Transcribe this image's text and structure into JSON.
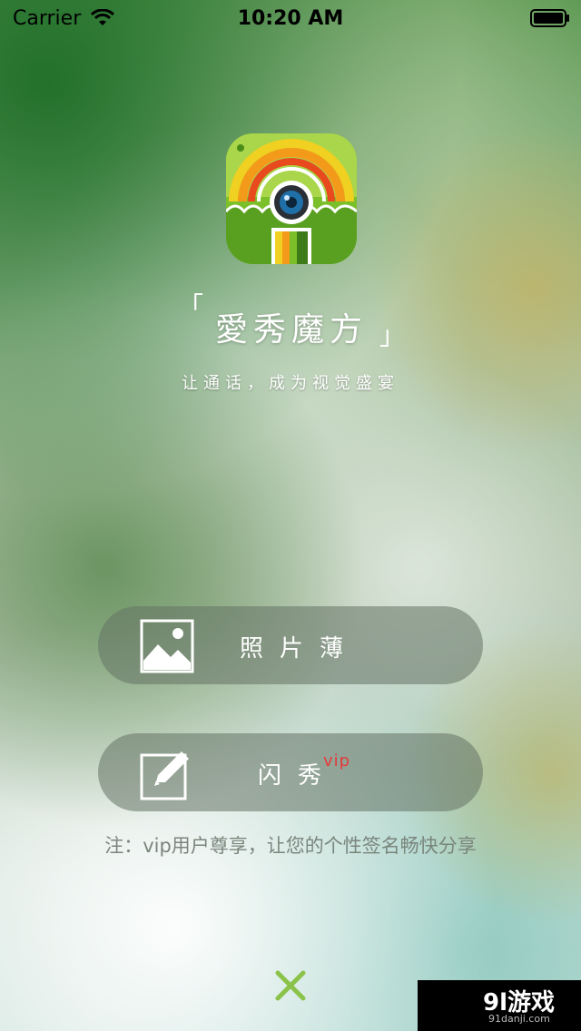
{
  "status_bar": {
    "carrier": "Carrier",
    "time": "10:20 AM"
  },
  "header": {
    "app_icon": "rainbow-camera-app-icon",
    "title_open_bracket": "「",
    "title": "愛秀魔方",
    "title_close_bracket": "」",
    "slogan": "让通话，成为视觉盛宴"
  },
  "buttons": {
    "album": {
      "label": "照片薄",
      "icon": "image-icon"
    },
    "flash_show": {
      "label": "闪秀",
      "badge": "vip",
      "icon": "edit-icon"
    }
  },
  "note": "注：vip用户尊享，让您的个性签名畅快分享",
  "close_icon": "close-icon",
  "watermark": {
    "text": "9l游戏",
    "sub": "91danji.com"
  },
  "colors": {
    "accent_green": "#8bc34a",
    "vip_red": "#e53a3a",
    "note_gray": "#7a867d"
  }
}
